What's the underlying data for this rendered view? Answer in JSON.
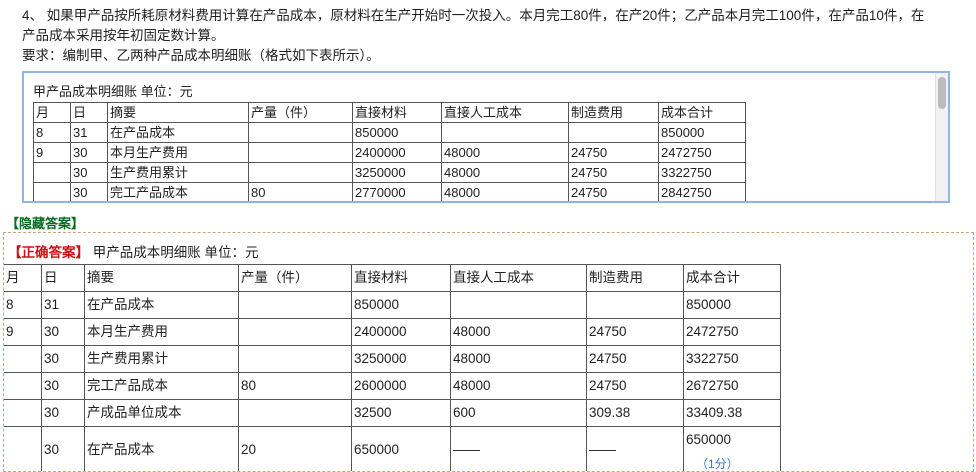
{
  "question": {
    "line1": "4、 如果甲产品按所耗原材料费用计算在产品成本，原材料在生产开始时一次投入。本月完工80件，在产20件；乙产品本月完工100件，在产品10件，在",
    "line2": "产品成本采用按年初固定数计算。",
    "line3": "要求：编制甲、乙两种产品成本明细账（格式如下表所示）。"
  },
  "scroll_table": {
    "caption": "甲产品成本明细账 单位：元",
    "headers": [
      "月",
      "日",
      "摘要",
      "产量（件）",
      "直接材料",
      "直接人工成本",
      "制造费用",
      "成本合计"
    ],
    "rows": [
      [
        "8",
        "31",
        "在产品成本",
        "",
        "850000",
        "",
        "",
        "850000"
      ],
      [
        "9",
        "30",
        "本月生产费用",
        "",
        "2400000",
        "48000",
        "24750",
        "2472750"
      ],
      [
        "",
        "30",
        "生产费用累计",
        "",
        "3250000",
        "48000",
        "24750",
        "3322750"
      ],
      [
        "",
        "30",
        "完工产品成本",
        "80",
        "2770000",
        "48000",
        "24750",
        "2842750"
      ]
    ]
  },
  "hidden_answer_label": "【隐藏答案】",
  "answer": {
    "tag": "【正确答案】",
    "caption": " 甲产品成本明细账 单位：元",
    "headers": [
      "月",
      "日",
      "摘要",
      "产量（件）",
      "直接材料",
      "直接人工成本",
      "制造费用",
      "成本合计"
    ],
    "rows": [
      [
        "8",
        "31",
        "在产品成本",
        "",
        "850000",
        "",
        "",
        "850000"
      ],
      [
        "9",
        "30",
        "本月生产费用",
        "",
        "2400000",
        "48000",
        "24750",
        "2472750"
      ],
      [
        "",
        "30",
        "生产费用累计",
        "",
        "3250000",
        "48000",
        "24750",
        "3322750"
      ],
      [
        "",
        "30",
        "完工产品成本",
        "80",
        "2600000",
        "48000",
        "24750",
        "2672750"
      ],
      [
        "",
        "30",
        "产成品单位成本",
        "",
        "32500",
        "600",
        "309.38",
        "33409.38"
      ],
      [
        "",
        "30",
        "在产品成本",
        "20",
        "650000",
        "——",
        "——",
        "650000"
      ]
    ],
    "score_note": "（1分）"
  },
  "colors": {
    "highlight": "#e53935",
    "answer_tag": "#cc1111",
    "hidden_label": "#0a6b21",
    "box_border": "#8fb4e6"
  }
}
